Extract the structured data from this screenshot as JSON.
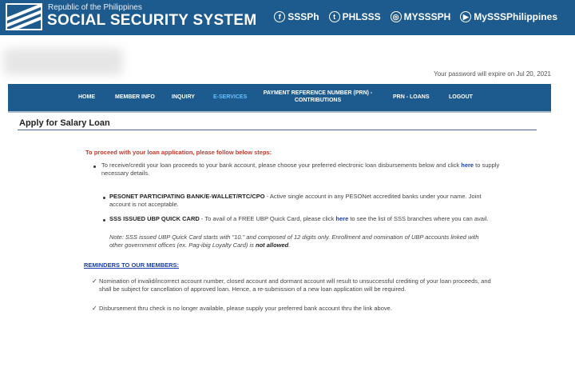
{
  "header": {
    "republic": "Republic of the Philippines",
    "title": "SOCIAL SECURITY SYSTEM",
    "socials": [
      {
        "icon": "facebook-icon",
        "glyph": "f",
        "label": "SSSPh"
      },
      {
        "icon": "twitter-icon",
        "glyph": "t",
        "label": "PHLSSS"
      },
      {
        "icon": "instagram-icon",
        "glyph": "◎",
        "label": "MYSSSPH"
      },
      {
        "icon": "youtube-icon",
        "glyph": "▶",
        "label": "MySSSPhilippines"
      }
    ]
  },
  "account": {
    "password_expiry": "Your password will expire on Jul 20, 2021"
  },
  "nav": {
    "items": [
      {
        "label": "HOME"
      },
      {
        "label": "MEMBER INFO"
      },
      {
        "label": "INQUIRY"
      },
      {
        "label": "E-SERVICES",
        "active": true
      },
      {
        "label": "PAYMENT REFERENCE NUMBER (PRN) - CONTRIBUTIONS"
      },
      {
        "label": "PRN - LOANS"
      },
      {
        "label": "LOGOUT"
      }
    ]
  },
  "page": {
    "title": "Apply for Salary Loan",
    "instruction": "To proceed with your loan application, please follow below steps:",
    "step1_before": "To receive/credit your loan proceeds to your bank account, please choose your preferred electronic loan disbursements below and click ",
    "step1_link": "here",
    "step1_after": " to supply necessary details.",
    "pesonet_bold": "PESONET PARTICIPATING BANK/E-WALLET/RTC/CPO",
    "pesonet_text": " - Active single account in any PESONet accredited banks under your name. Joint account is not acceptable.",
    "ubp_bold": "SSS ISSUED UBP QUICK CARD",
    "ubp_before": " - To avail of a FREE UBP Quick Card, please click ",
    "ubp_link": "here",
    "ubp_after": " to see the list of SSS branches where you can avail.",
    "ubp_note": "Note: SSS issued UBP Quick Card starts with \"10.\" and composed of 12 digits only. Enrollment and nomination of UBP accounts linked with other government offices (ex. Pag-ibig Loyalty Card) is ",
    "ubp_note_bold": "not allowed",
    "ubp_note_end": ".",
    "reminders_title": "REMINDERS TO OUR MEMBERS:",
    "check_glyph": "✓",
    "reminder1": "Nomination of invalid/incorrect account number, closed account and dormant account will result to unsuccessful crediting of your loan proceeds, and shall be subject for cancellation of approved loan. Hence, a re-submission of a new loan application will be required.",
    "reminder2": "Disbursement thru check is no longer available, please supply your preferred bank account thru the link above."
  }
}
